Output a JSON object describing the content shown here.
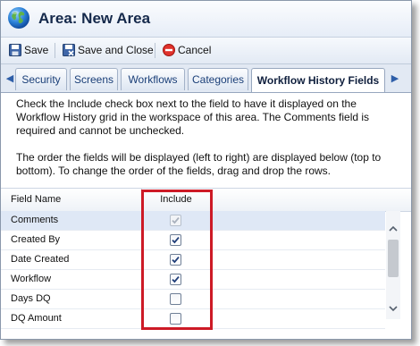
{
  "window": {
    "title": "Area: New Area",
    "icon": "globe-icon"
  },
  "toolbar": {
    "save_label": "Save",
    "save_close_label": "Save and Close",
    "cancel_label": "Cancel"
  },
  "tabs": [
    {
      "label": "Security",
      "active": false
    },
    {
      "label": "Screens",
      "active": false
    },
    {
      "label": "Workflows",
      "active": false
    },
    {
      "label": "Categories",
      "active": false
    },
    {
      "label": "Workflow History Fields",
      "active": true
    }
  ],
  "description": {
    "paragraph1": "Check the Include check box next to the field to have it displayed on the Workflow History grid in the workspace of this area. The Comments field is required and cannot be unchecked.",
    "paragraph2": "The order the fields will be displayed (left to right) are displayed below (top to bottom). To change the order of the fields, drag and drop the rows."
  },
  "grid": {
    "columns": [
      "Field Name",
      "Include"
    ],
    "rows": [
      {
        "field": "Comments",
        "include": true,
        "disabled": true,
        "selected": true
      },
      {
        "field": "Created By",
        "include": true,
        "disabled": false,
        "selected": false
      },
      {
        "field": "Date Created",
        "include": true,
        "disabled": false,
        "selected": false
      },
      {
        "field": "Workflow",
        "include": true,
        "disabled": false,
        "selected": false
      },
      {
        "field": "Days DQ",
        "include": false,
        "disabled": false,
        "selected": false
      },
      {
        "field": "DQ Amount",
        "include": false,
        "disabled": false,
        "selected": false
      }
    ]
  },
  "colors": {
    "accent": "#1a3f78",
    "highlight_box": "#cd1a26",
    "selected_row": "#dfe8f6"
  }
}
